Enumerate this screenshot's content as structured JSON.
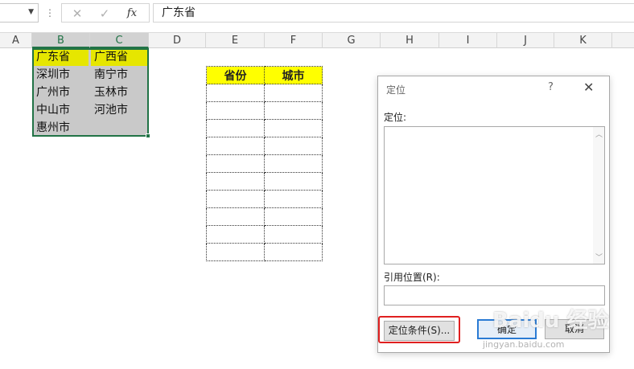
{
  "formula_bar": {
    "name_box_value": "",
    "cancel_symbol": "✕",
    "enter_symbol": "✓",
    "fx_symbol": "fx",
    "content": "广东省"
  },
  "columns": [
    "A",
    "B",
    "C",
    "D",
    "E",
    "F",
    "G",
    "H",
    "I",
    "J",
    "K"
  ],
  "source_cells": {
    "B": [
      "广东省",
      "深圳市",
      "广州市",
      "中山市",
      "惠州市"
    ],
    "C": [
      "广西省",
      "南宁市",
      "玉林市",
      "河池市"
    ]
  },
  "target_table": {
    "headers": [
      "省份",
      "城市"
    ],
    "empty_rows": 10
  },
  "dialog": {
    "title": "定位",
    "help": "?",
    "close": "✕",
    "goto_label": "定位:",
    "reference_label": "引用位置(R):",
    "reference_value": "",
    "special_button": "定位条件(S)...",
    "ok_button": "确定",
    "cancel_button": "取消"
  },
  "colors": {
    "selection_green": "#217346",
    "header_yellow": "#ffff00",
    "highlight_yellow": "#e6e600",
    "range_gray": "#c9c9c9",
    "annotation_red": "#e02020"
  },
  "watermark": {
    "text": "Baidu 经验",
    "url": "jingyan.baidu.com"
  }
}
